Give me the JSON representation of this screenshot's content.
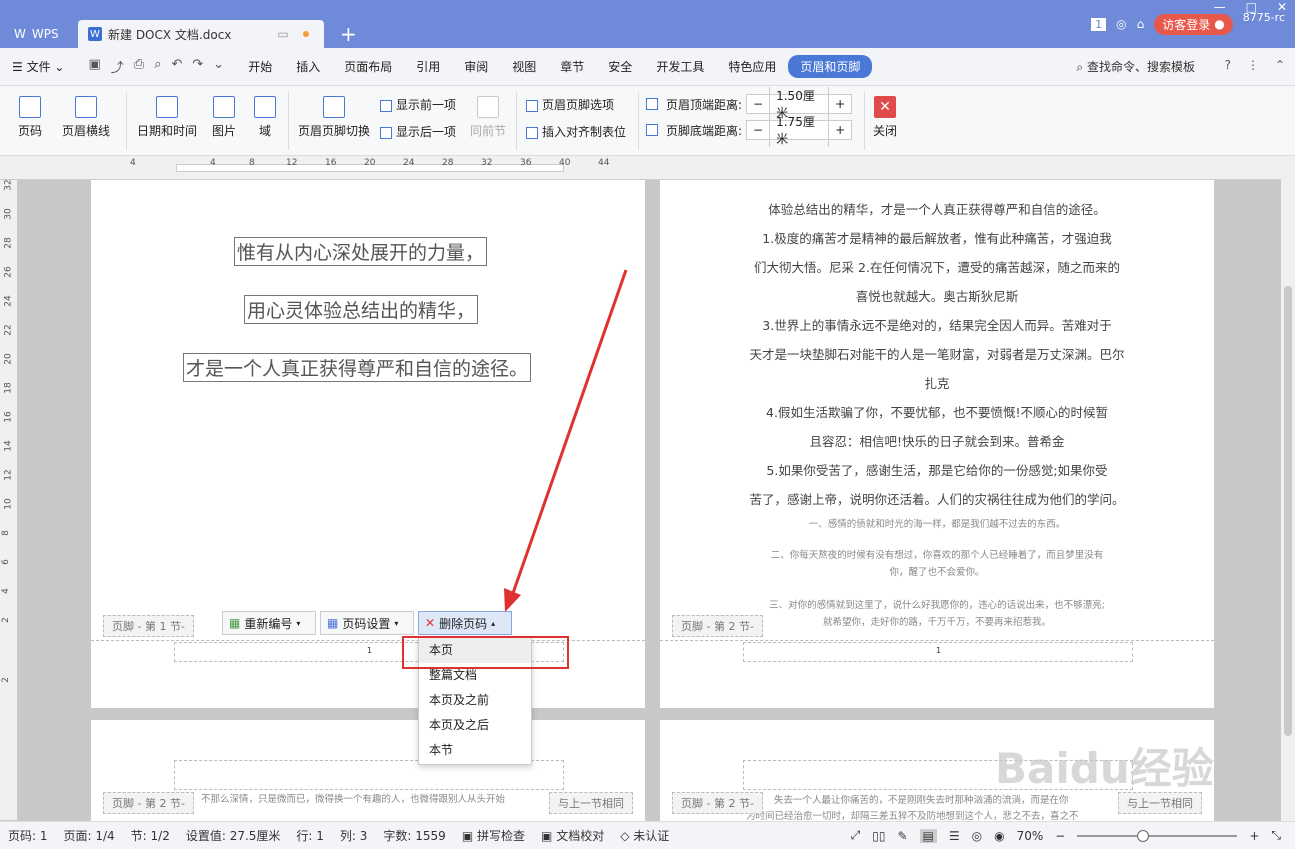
{
  "titlebar": {
    "app": "WPS",
    "doc_tab": "新建 DOCX 文档.docx",
    "badge": "1",
    "login": "访客登录",
    "user_id": "8775-rc"
  },
  "menu": {
    "file": "文件",
    "items": [
      "开始",
      "插入",
      "页面布局",
      "引用",
      "审阅",
      "视图",
      "章节",
      "安全",
      "开发工具",
      "特色应用"
    ],
    "active": "页眉和页脚",
    "search": "查找命令、搜索模板"
  },
  "ribbon": {
    "page_number": "页码",
    "header_line": "页眉横线",
    "datetime": "日期和时间",
    "image": "图片",
    "field": "域",
    "switch": "页眉页脚切换",
    "show_prev": "显示前一项",
    "show_next": "显示后一项",
    "same_as_prev": "同前节",
    "options": "页眉页脚选项",
    "insert_tab": "插入对齐制表位",
    "header_top_label": "页眉顶端距离:",
    "header_top_value": "1.50厘米",
    "footer_bottom_label": "页脚底端距离:",
    "footer_bottom_value": "1.75厘米",
    "close": "关闭"
  },
  "ruler": {
    "h_ticks": [
      "4",
      "4",
      "8",
      "12",
      "16",
      "20",
      "24",
      "28",
      "32",
      "36",
      "40",
      "44"
    ],
    "v_ticks": [
      "32",
      "30",
      "28",
      "26",
      "24",
      "22",
      "20",
      "18",
      "16",
      "14",
      "12",
      "10",
      "8",
      "6",
      "4",
      "2",
      "2"
    ]
  },
  "page1": {
    "lines": [
      "惟有从内心深处展开的力量，",
      "用心灵体验总结出的精华，",
      "才是一个人真正获得尊严和自信的途径。"
    ],
    "footer_label": "页脚 - 第 1 节-",
    "page_num": "1"
  },
  "page2": {
    "lines": [
      "体验总结出的精华，才是一个人真正获得尊严和自信的途径。",
      "1.极度的痛苦才是精神的最后解放者，惟有此种痛苦，才强迫我",
      "们大彻大悟。尼采 2.在任何情况下，遭受的痛苦越深，随之而来的",
      "喜悦也就越大。奥古斯狄尼斯",
      "3.世界上的事情永远不是绝对的，结果完全因人而异。苦难对于",
      "天才是一块垫脚石对能干的人是一笔财富，对弱者是万丈深渊。巴尔",
      "扎克",
      "4.假如生活欺骗了你，不要忧郁，也不要愤慨!不顺心的时候暂",
      "且容忍：相信吧!快乐的日子就会到来。普希金",
      "5.如果你受苦了，感谢生活，那是它给你的一份感觉;如果你受",
      "苦了，感谢上帝，说明你还活着。人们的灾祸往往成为他们的学问。"
    ],
    "small": [
      "一、感情的债就和时光的海一样，都是我们越不过去的东西。",
      "二、你每天熬夜的时候有没有想过，你喜欢的那个人已经睡着了，而且梦里没有",
      "你，醒了也不会爱你。",
      "三、对你的感情就到这里了，说什么好我愿你的，违心的话说出来，也不够漂亮;",
      "就希望你，走好你的路，千万千万，不要再来招惹我。"
    ],
    "footer_label": "页脚 - 第 2 节-",
    "page_num": "1"
  },
  "page3": {
    "footer_label": "页脚 - 第 2 节-",
    "link_label": "与上一节相同",
    "text": "不那么深情，只是微而已，微得换一个有趣的人，也微得跟别人从头开始"
  },
  "page4": {
    "footer_label": "页脚 - 第 2 节-",
    "link_label": "与上一节相同",
    "text1": "失去一个人最让你痛苦的，不是刚刚失去时那种汹涌的流淌，而是在你",
    "text2": "为时间已经治愈一切时，却隔三差五猝不及防地想到这个人，悲之不去，喜之不"
  },
  "toolbar": {
    "renumber": "重新编号",
    "page_setup": "页码设置",
    "delete": "删除页码"
  },
  "dropdown": [
    "本页",
    "整篇文档",
    "本页及之前",
    "本页及之后",
    "本节"
  ],
  "status": {
    "page": "页码: 1",
    "pages": "页面: 1/4",
    "section": "节: 1/2",
    "setting": "设置值: 27.5厘米",
    "row": "行: 1",
    "col": "列: 3",
    "words": "字数: 1559",
    "spell": "拼写检查",
    "proof": "文档校对",
    "auth": "未认证",
    "zoom": "70%"
  },
  "watermark": "Baidu经验"
}
